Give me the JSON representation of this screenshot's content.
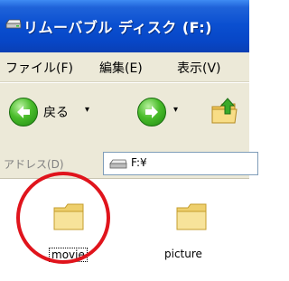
{
  "window": {
    "title": "リムーバブル ディスク (F:)",
    "title_icon": "drive-icon"
  },
  "menu": {
    "items": [
      {
        "label": "ファイル(F)"
      },
      {
        "label": "編集(E)"
      },
      {
        "label": "表示(V)"
      }
    ]
  },
  "toolbar": {
    "back_label": "戻る",
    "back_dropdown": "▾",
    "forward_dropdown": "▾",
    "up_icon": "folder-up-icon"
  },
  "address": {
    "label": "アドレス(D)",
    "value": "F:¥",
    "icon": "drive-icon"
  },
  "files": [
    {
      "name": "movie",
      "icon": "folder-icon",
      "focused": true
    },
    {
      "name": "picture",
      "icon": "folder-icon",
      "focused": false
    }
  ],
  "colors": {
    "title_bar": "#0a4fd0",
    "chrome": "#ece9d8",
    "highlight_ring": "#e0141c",
    "folder": "#f6dc83"
  }
}
